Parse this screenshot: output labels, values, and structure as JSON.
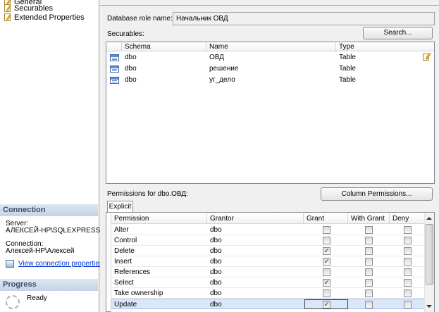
{
  "left_pane": {
    "pages": [
      {
        "label": "General",
        "icon": "page-icon"
      },
      {
        "label": "Securables",
        "icon": "page-icon"
      },
      {
        "label": "Extended Properties",
        "icon": "page-icon"
      }
    ],
    "connection": {
      "header": "Connection",
      "server_label": "Server:",
      "server_value": "АЛЕКСЕЙ-HP\\SQLEXPRESS",
      "connection_label": "Connection:",
      "connection_value": "Алексей-HP\\Алексей",
      "view_link": "View connection properties"
    },
    "progress": {
      "header": "Progress",
      "status": "Ready"
    }
  },
  "main": {
    "role_name_label": "Database role name:",
    "role_name_value": "Начальник ОВД",
    "securables_label": "Securables:",
    "search_button": "Search...",
    "securables_columns": [
      "Schema",
      "Name",
      "Type"
    ],
    "securables_rows": [
      {
        "schema": "dbo",
        "name": "ОВД",
        "type": "Table"
      },
      {
        "schema": "dbo",
        "name": "решение",
        "type": "Table"
      },
      {
        "schema": "dbo",
        "name": "уг_дело",
        "type": "Table"
      }
    ],
    "permissions_label": "Permissions for dbo.ОВД:",
    "column_permissions_button": "Column Permissions...",
    "tab_label": "Explicit",
    "permissions_columns": [
      "Permission",
      "Grantor",
      "Grant",
      "With Grant",
      "Deny"
    ],
    "permissions_rows": [
      {
        "permission": "Alter",
        "grantor": "dbo",
        "grant": false,
        "with_grant": false,
        "deny": false
      },
      {
        "permission": "Control",
        "grantor": "dbo",
        "grant": false,
        "with_grant": false,
        "deny": false
      },
      {
        "permission": "Delete",
        "grantor": "dbo",
        "grant": true,
        "with_grant": false,
        "deny": false
      },
      {
        "permission": "Insert",
        "grantor": "dbo",
        "grant": true,
        "with_grant": false,
        "deny": false
      },
      {
        "permission": "References",
        "grantor": "dbo",
        "grant": false,
        "with_grant": false,
        "deny": false
      },
      {
        "permission": "Select",
        "grantor": "dbo",
        "grant": true,
        "with_grant": false,
        "deny": false
      },
      {
        "permission": "Take ownership",
        "grantor": "dbo",
        "grant": false,
        "with_grant": false,
        "deny": false
      },
      {
        "permission": "Update",
        "grantor": "dbo",
        "grant": true,
        "with_grant": false,
        "deny": false,
        "selected": true
      }
    ],
    "check_glyph": "✓"
  },
  "colors": {
    "section_header": "#3b4f6b",
    "link": "#0033cc",
    "selected_row": "#d9e7f8"
  }
}
